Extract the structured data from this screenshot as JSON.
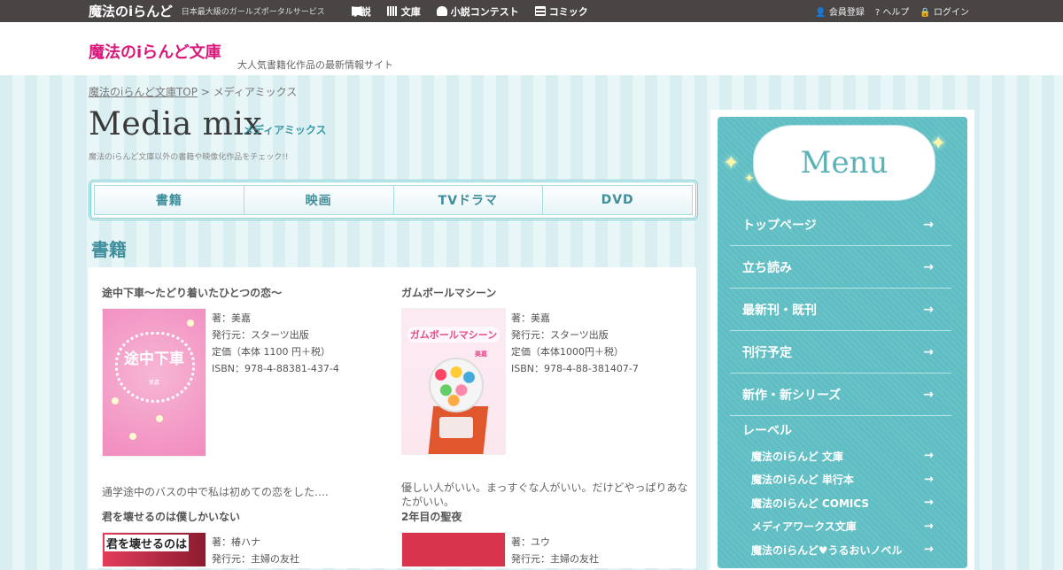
{
  "topbar": {
    "logo": "魔法のiらんど",
    "tagline": "日本最大級のガールズポータルサービス",
    "nav": [
      {
        "label": "小説",
        "icon": "book-open-icon"
      },
      {
        "label": "文庫",
        "icon": "bookshelf-icon"
      },
      {
        "label": "小説コンテスト",
        "icon": "contest-icon"
      },
      {
        "label": "コミック",
        "icon": "comic-icon"
      }
    ],
    "user": {
      "register": "会員登録",
      "help": "ヘルプ",
      "login": "ログイン"
    }
  },
  "header": {
    "brand": "魔法のiらんど文庫",
    "subtitle": "大人気書籍化作品の最新情報サイト"
  },
  "breadcrumb": {
    "home": "魔法のiらんど文庫TOP",
    "separator": " > ",
    "current": "メディアミックス"
  },
  "page": {
    "title": "Media mix",
    "title_ja": "メディアミックス",
    "description": "魔法のiらんど文庫以外の書籍や映像化作品をチェック!!"
  },
  "tabs": [
    "書籍",
    "映画",
    "TVドラマ",
    "DVD"
  ],
  "section": {
    "title": "書籍"
  },
  "books": [
    {
      "title": "途中下車～たどり着いたひとつの恋～",
      "author": "著：美嘉",
      "publisher": "発行元：スターツ出版",
      "price": "定価（本体 1100 円＋税）",
      "isbn": "ISBN：978-4-88381-437-4",
      "blurb": "通学途中のバスの中で私は初めての恋をした….",
      "cover_text": "途中下車",
      "cover_author": "美嘉"
    },
    {
      "title": "ガムボールマシーン",
      "author": "著：美嘉",
      "publisher": "発行元：スターツ出版",
      "price": "定価（本体1000円＋税）",
      "isbn": "ISBN：978-4-88-381407-7",
      "blurb": "優しい人がいい。まっすぐな人がいい。だけどやっぱりあなたがいい。",
      "cover_text": "ガムボールマシーン",
      "cover_author": "美嘉"
    },
    {
      "title": "君を壊せるのは僕しかいない",
      "author": "著：椿ハナ",
      "publisher": "発行元：主婦の友社",
      "cover_text": "君を壊せるのは"
    },
    {
      "title": "2年目の聖夜",
      "author": "著：ユウ",
      "publisher": "発行元：主婦の友社"
    }
  ],
  "menu": {
    "title": "Menu",
    "items": [
      "トップページ",
      "立ち読み",
      "最新刊・既刊",
      "刊行予定",
      "新作・新シリーズ"
    ],
    "label_group": "レーベル",
    "labels": [
      "魔法のiらんど 文庫",
      "魔法のiらんど 単行本",
      "魔法のiらんど COMICS",
      "メディアワークス文庫",
      "魔法のiらんど♥うるおいノベル"
    ],
    "arrow": "→"
  },
  "colors": {
    "accent": "#3f8e9c",
    "brand": "#d9187a",
    "menu_bg": "#5fbcc1",
    "topbar": "#4a4545"
  }
}
